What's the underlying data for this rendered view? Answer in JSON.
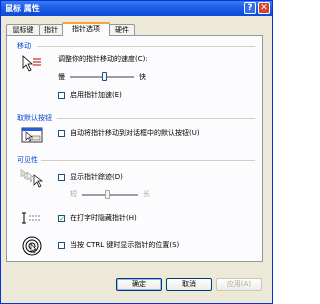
{
  "window": {
    "title": "鼠标 属性",
    "help_glyph": "?",
    "close_glyph": "✕"
  },
  "tabs": [
    {
      "label": "鼠标键"
    },
    {
      "label": "指针"
    },
    {
      "label": "指针选项"
    },
    {
      "label": "硬件"
    }
  ],
  "motion": {
    "title": "移动",
    "speed_label": "调整你的指针移动的速度(C):",
    "slow": "慢",
    "fast": "快",
    "speed_level": 0.55,
    "enhance_label": "启用指针加速(E)",
    "enhance_checked": false
  },
  "snap": {
    "title": "取默认按钮",
    "label": "自动将指针移动到对话框中的默认按钮(U)",
    "checked": false
  },
  "visibility": {
    "title": "可见性",
    "trails_label": "显示指针踪迹(D)",
    "trails_checked": false,
    "short": "短",
    "long": "长",
    "trails_level": 0.45,
    "hide_label": "在打字时隐藏指针(H)",
    "hide_checked": true,
    "ctrl_label": "当按 CTRL 键时显示指针的位置(S)",
    "ctrl_checked": false
  },
  "buttons": {
    "ok": "确定",
    "cancel": "取消",
    "apply": "应用(A)"
  },
  "colors": {
    "accent": "#0046d5",
    "titlebar": "#1f5ee8",
    "check": "#21a121"
  }
}
